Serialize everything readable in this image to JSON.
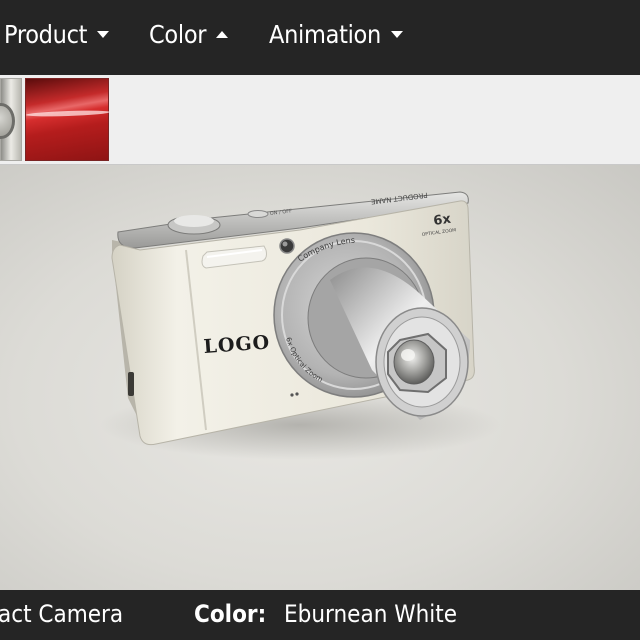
{
  "menu": {
    "items": [
      {
        "label": "Product",
        "state": "collapsed"
      },
      {
        "label": "Color",
        "state": "expanded"
      },
      {
        "label": "Animation",
        "state": "collapsed"
      }
    ]
  },
  "swatches": [
    {
      "name": "silver",
      "color": "#c9c8c2"
    },
    {
      "name": "red",
      "color": "#c42424"
    }
  ],
  "camera": {
    "logo": "LOGO",
    "product_name": "PRODUCT NAME",
    "zoom": "6x",
    "zoom_sub": "OPTICAL ZOOM",
    "lens_brand": "Company Lens",
    "lens_spec": "6x Optical Zoom",
    "body_color": "#ebe8dc"
  },
  "footer": {
    "product_fragment": "act Camera",
    "color_label": "Color:",
    "color_value": "Eburnean White"
  }
}
